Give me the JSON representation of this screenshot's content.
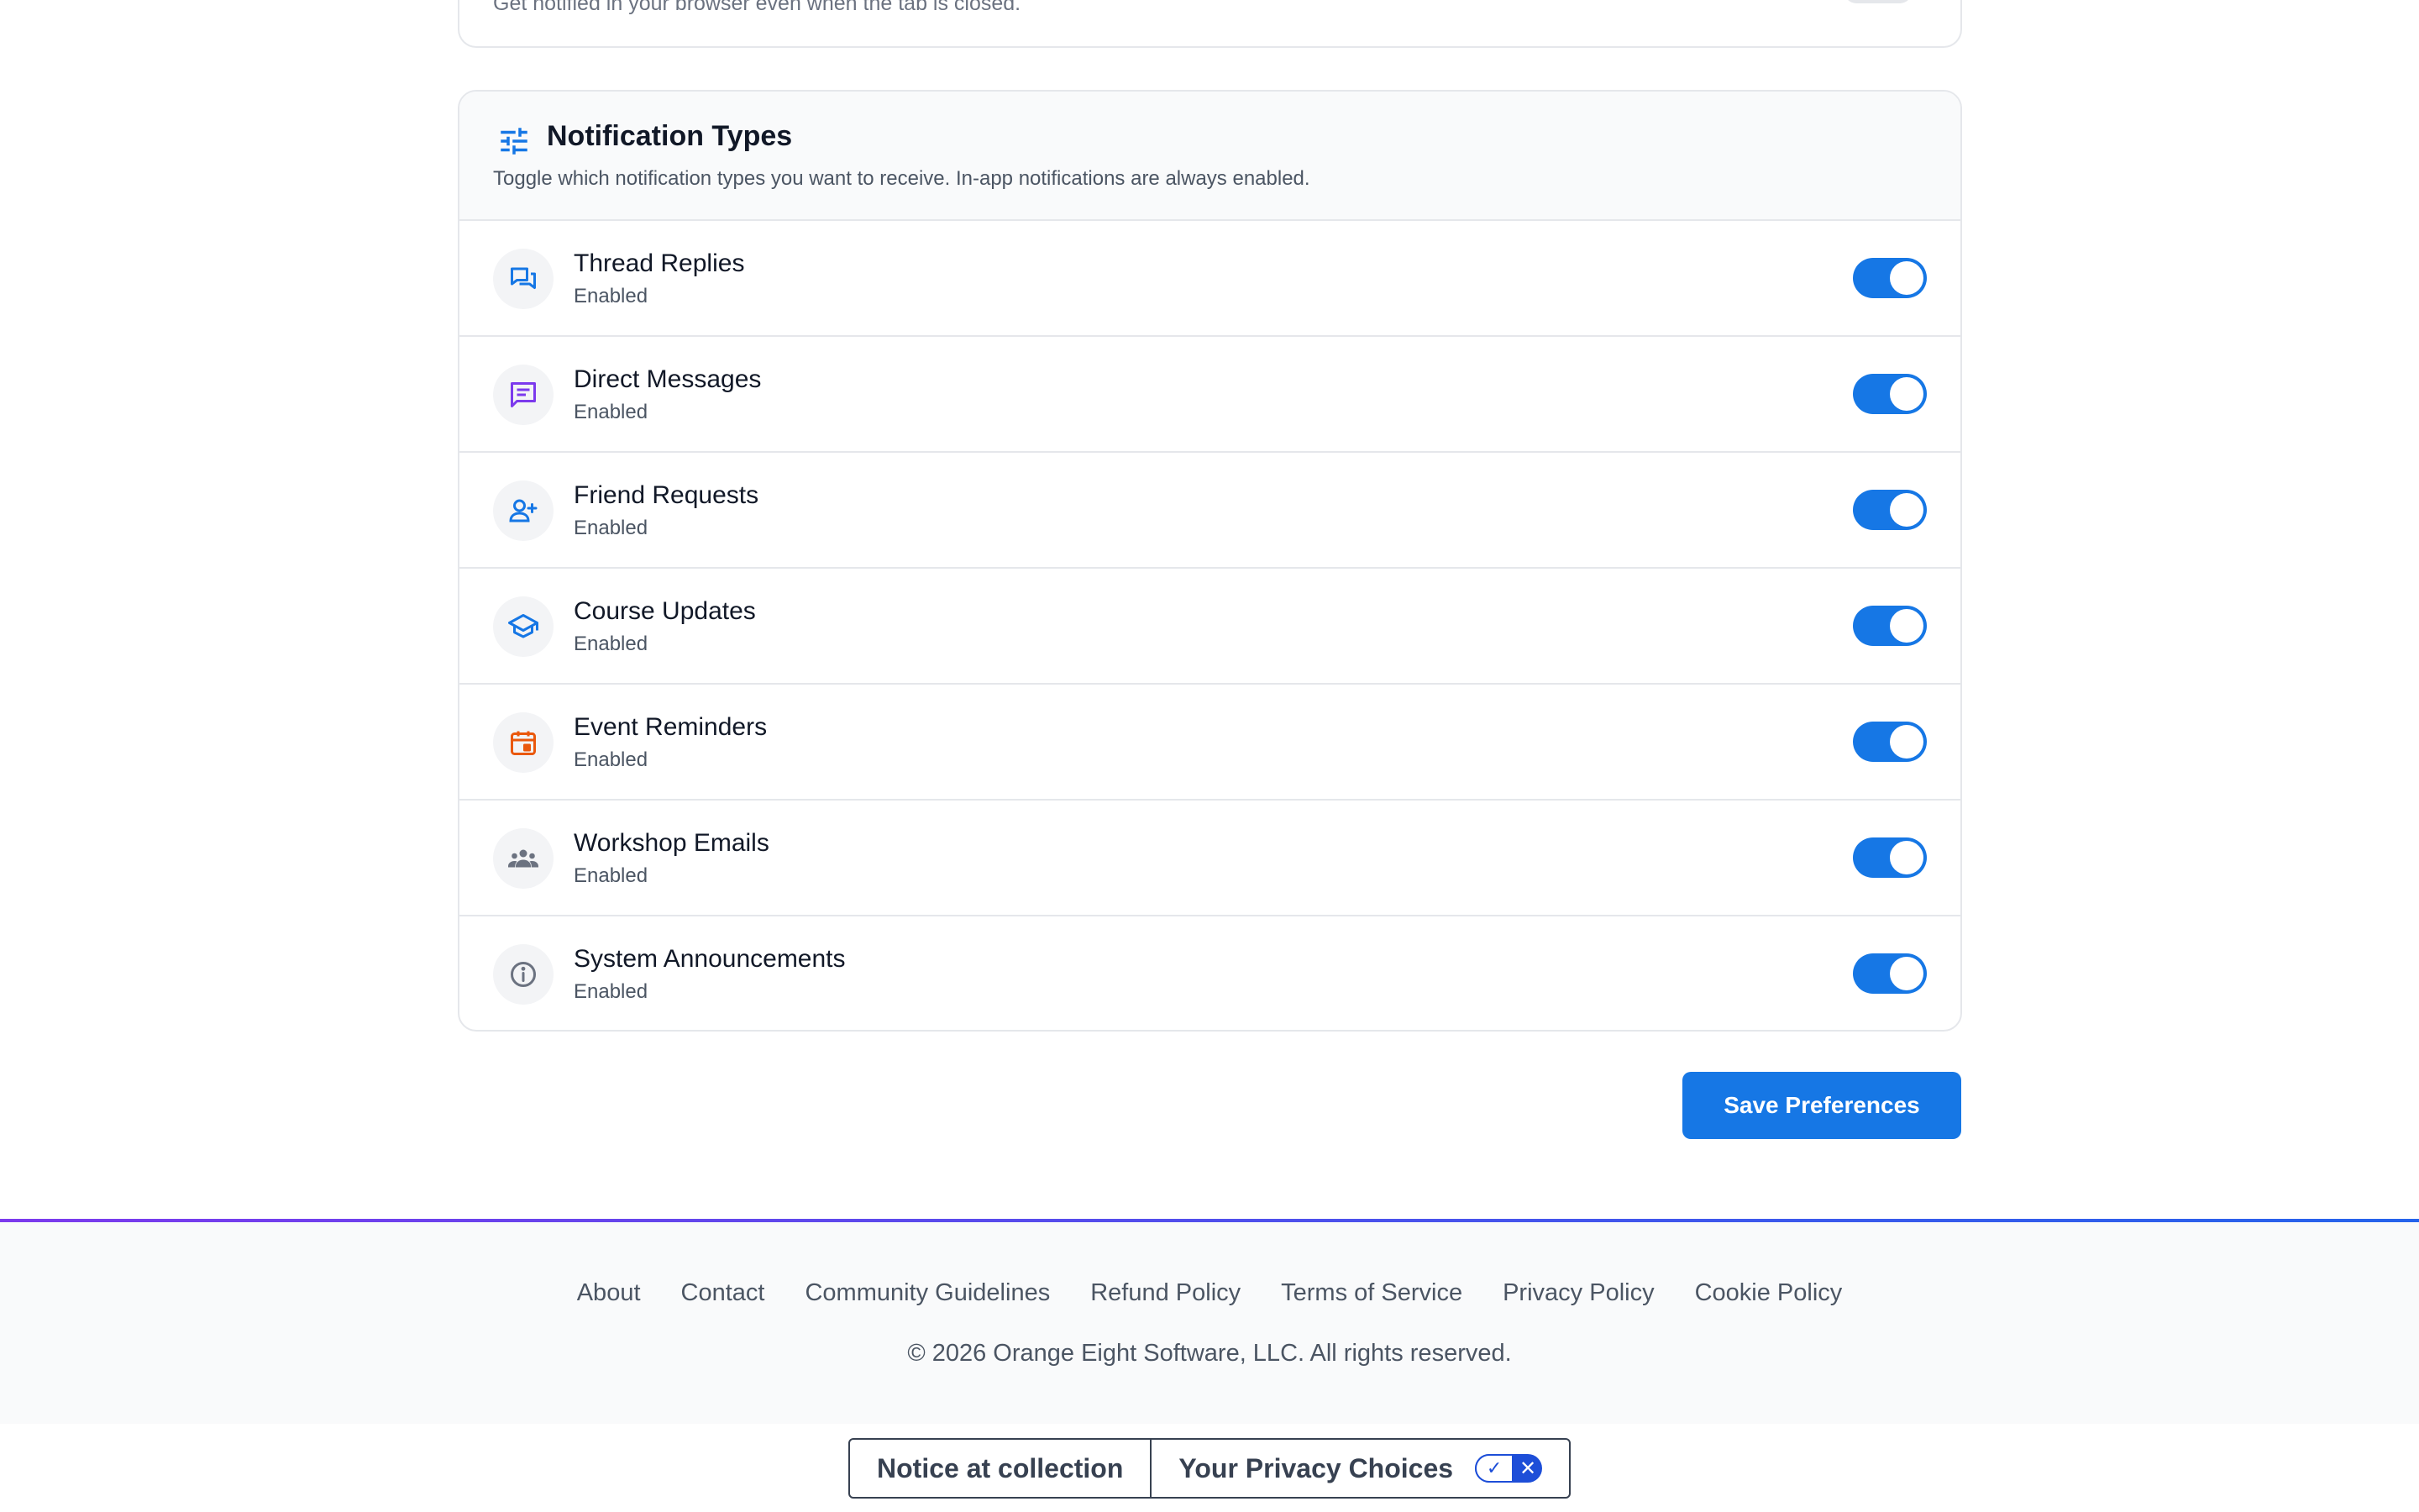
{
  "push_card": {
    "description": "Get notified in your browser even when the tab is closed."
  },
  "notification_types": {
    "title": "Notification Types",
    "subtitle": "Toggle which notification types you want to receive. In-app notifications are always enabled.",
    "icon": "tune-icon",
    "items": [
      {
        "label": "Thread Replies",
        "status": "Enabled",
        "icon": "forum-icon",
        "icon_color": "#1677e5",
        "enabled": true
      },
      {
        "label": "Direct Messages",
        "status": "Enabled",
        "icon": "chat-icon",
        "icon_color": "#7c3aed",
        "enabled": true
      },
      {
        "label": "Friend Requests",
        "status": "Enabled",
        "icon": "person-add-icon",
        "icon_color": "#1677e5",
        "enabled": true
      },
      {
        "label": "Course Updates",
        "status": "Enabled",
        "icon": "school-icon",
        "icon_color": "#1677e5",
        "enabled": true
      },
      {
        "label": "Event Reminders",
        "status": "Enabled",
        "icon": "calendar-icon",
        "icon_color": "#ea580c",
        "enabled": true
      },
      {
        "label": "Workshop Emails",
        "status": "Enabled",
        "icon": "groups-icon",
        "icon_color": "#6b7280",
        "enabled": true
      },
      {
        "label": "System Announcements",
        "status": "Enabled",
        "icon": "info-icon",
        "icon_color": "#6b7280",
        "enabled": true
      }
    ]
  },
  "save_button": "Save Preferences",
  "footer": {
    "links": [
      "About",
      "Contact",
      "Community Guidelines",
      "Refund Policy",
      "Terms of Service",
      "Privacy Policy",
      "Cookie Policy"
    ],
    "copyright": "© 2026 Orange Eight Software, LLC. All rights reserved."
  },
  "privacy_bar": {
    "notice": "Notice at collection",
    "choices": "Your Privacy Choices",
    "toggle_on": "✓",
    "toggle_off": "✕"
  },
  "colors": {
    "accent": "#1677e5",
    "footer_gradient_start": "#7c3aed",
    "footer_gradient_end": "#2563eb"
  }
}
